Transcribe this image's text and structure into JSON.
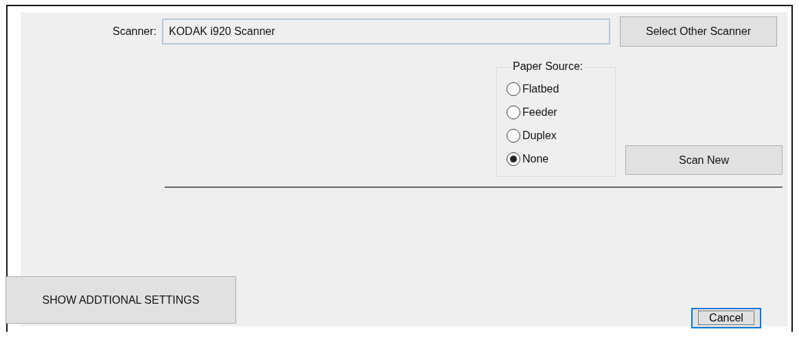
{
  "scanner": {
    "label": "Scanner:",
    "value": "KODAK i920 Scanner"
  },
  "select_button": "Select Other Scanner",
  "paper_source": {
    "title": "Paper Source:",
    "options": [
      {
        "label": "Flatbed",
        "selected": false
      },
      {
        "label": "Feeder",
        "selected": false
      },
      {
        "label": "Duplex",
        "selected": false
      },
      {
        "label": "None",
        "selected": true
      }
    ]
  },
  "scan_button": "Scan New",
  "settings_button": "SHOW ADDTIONAL SETTINGS",
  "cancel_button": {
    "label": "Cancel",
    "focused": true
  }
}
